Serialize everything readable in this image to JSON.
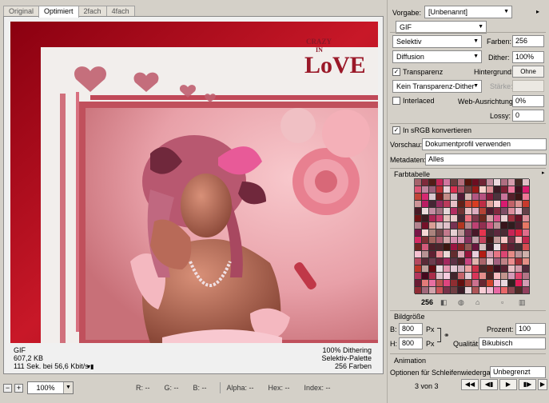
{
  "tabs": [
    "Original",
    "Optimiert",
    "2fach",
    "4fach"
  ],
  "artwork": {
    "logo_top": "CRAZY",
    "logo_mid": "IN",
    "logo_main": "LoVE"
  },
  "info_left": {
    "format": "GIF",
    "size": "607,2 KB",
    "time": "111 Sek. bei 56,6 Kbit/s"
  },
  "info_right": {
    "dither": "100% Dithering",
    "palette": "Selektiv-Palette",
    "colors": "256 Farben"
  },
  "status": {
    "zoom": "100%",
    "r": "R: --",
    "g": "G: --",
    "b": "B: --",
    "alpha": "Alpha: --",
    "hex": "Hex: --",
    "index": "Index: --"
  },
  "settings": {
    "preset_label": "Vorgabe:",
    "preset_value": "[Unbenannt]",
    "format": "GIF",
    "reduction": "Selektiv",
    "colors_label": "Farben:",
    "colors_value": "256",
    "dither_algo": "Diffusion",
    "dither_label": "Dither:",
    "dither_value": "100%",
    "transparency_label": "Transparenz",
    "matte_label": "Hintergrund:",
    "matte_value": "Ohne",
    "trans_dither": "Kein Transparenz-Dither",
    "amount_label": "Stärke:",
    "amount_value": "",
    "interlaced_label": "Interlaced",
    "websnap_label": "Web-Ausrichtung:",
    "websnap_value": "0%",
    "lossy_label": "Lossy:",
    "lossy_value": "0",
    "srgb_label": "In sRGB konvertieren",
    "preview_label": "Vorschau:",
    "preview_value": "Dokumentprofil verwenden",
    "metadata_label": "Metadaten:",
    "metadata_value": "Alles"
  },
  "color_table": {
    "title": "Farbtabelle",
    "count": "256"
  },
  "image_size": {
    "title": "Bildgröße",
    "w_label": "B:",
    "w_value": "800",
    "h_label": "H:",
    "h_value": "800",
    "unit": "Px",
    "percent_label": "Prozent:",
    "percent_value": "100",
    "quality_label": "Qualität:",
    "quality_value": "Bikubisch"
  },
  "animation": {
    "title": "Animation",
    "loop_label": "Optionen für Schleifenwiedergabe:",
    "loop_value": "Unbegrenzt",
    "frame": "3 von 3"
  },
  "colors": {
    "accent": "#c01020",
    "rose": "#e88a98",
    "panel": "#d4d0c8"
  }
}
